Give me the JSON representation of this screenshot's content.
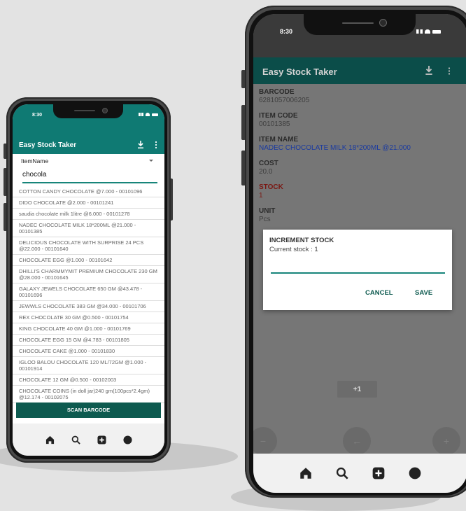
{
  "colors": {
    "accent": "#0f7a73",
    "field_highlight": "#1a3aa0",
    "stock_label": "#b3261e",
    "button_dark": "#0d5a4f"
  },
  "left_phone": {
    "status": {
      "time": "8:30"
    },
    "appbar": {
      "title": "Easy Stock Taker",
      "download_icon": "download-icon",
      "menu_icon": "more-vertical-icon"
    },
    "dropdown": {
      "selected": "ItemName"
    },
    "search": {
      "value": "chocola"
    },
    "items": [
      "COTTON CANDY CHOCOLATE @7.000 - 00101096",
      "DIDO CHOCOLATE @2.000 - 00101241",
      "saudia chocolate milk 1litre @6.000 - 00101278",
      "NADEC CHOCOLATE MILK 18*200ML @21.000 - 00101385",
      "DELICIOUS CHOCOLATE WITH SURPRISE 24 PCS @22.000 - 00101640",
      "CHOCOLATE EGG @1.000 - 00101642",
      "DHILLI'S CHARMMYMIT PREMIUM CHOCOLATE 230 GM @28.000 - 00101645",
      "GALAXY JEWELS CHOCOLATE 650 GM @43.478 - 00101696",
      "JEWWLS CHOCOLATE 383 GM @34.000 - 00101706",
      "REX CHOCOLATE 30 GM @0.500 - 00101754",
      "KING CHOCOLATE 40 GM @1.000 - 00101769",
      "CHOCOLATE EGG 15 GM @4.783 - 00101805",
      "CHOCOLATE CAKE @1.000 - 00101830",
      "IGLOO BALOU CHOCOLATE 120 ML/72GM @1.000 - 00101914",
      "CHOCOLATE 12 GM @0.500 - 00102003",
      "CHOCOLATE COINS (in doll jar)240 gm(100pcs*2.4gm) @12.174 - 00102075"
    ],
    "scan_button": "SCAN BARCODE"
  },
  "right_phone": {
    "status": {
      "time": "8:30"
    },
    "appbar": {
      "title": "Easy Stock Taker"
    },
    "fields": {
      "barcode": {
        "label": "BARCODE",
        "value": "6281057006205"
      },
      "item_code": {
        "label": "ITEM CODE",
        "value": "00101385"
      },
      "item_name": {
        "label": "ITEM NAME",
        "value": "NADEC CHOCOLATE MILK 18*200ML @21.000"
      },
      "cost": {
        "label": "COST",
        "value": "20.0"
      },
      "stock": {
        "label": "STOCK",
        "value": "1"
      },
      "unit": {
        "label": "UNIT",
        "value": "Pcs"
      }
    },
    "dialog": {
      "title": "INCREMENT STOCK",
      "message": "Current stock : 1",
      "input_value": "",
      "cancel": "CANCEL",
      "save": "SAVE"
    },
    "buttons": {
      "plus_one": "+1",
      "minus": "−",
      "back": "←",
      "plus": "+"
    }
  }
}
